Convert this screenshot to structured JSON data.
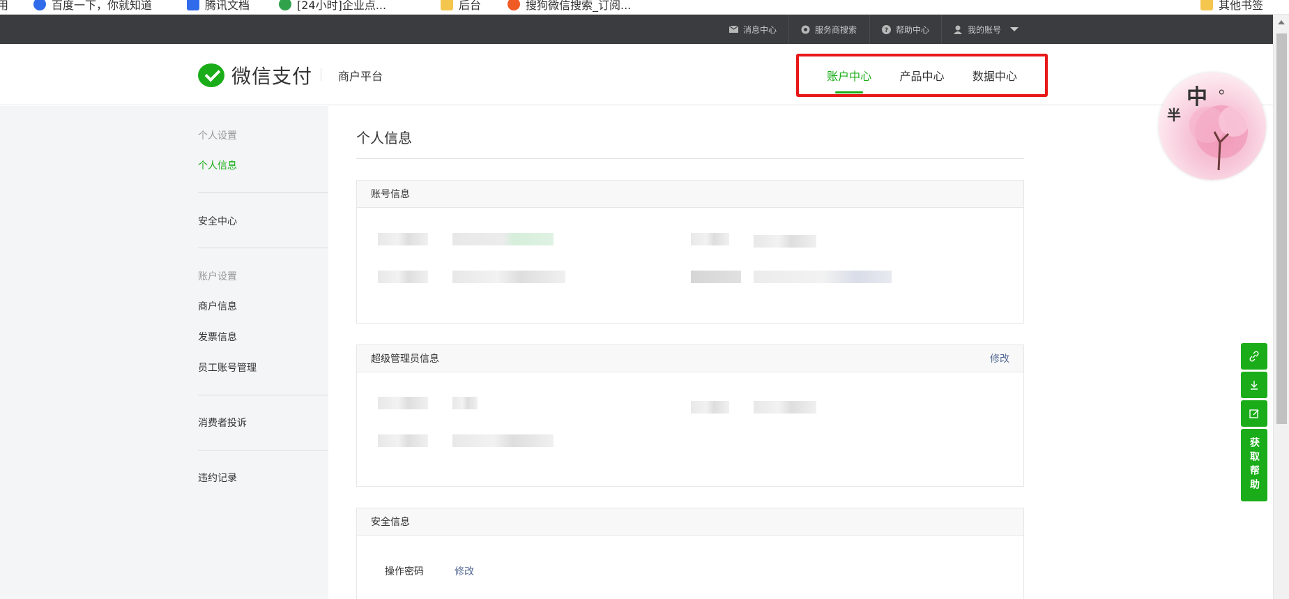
{
  "bookmarks": [
    {
      "label": "用",
      "icon": "folder-icon"
    },
    {
      "label": "百度一下，你就知道",
      "icon": "baidu-icon"
    },
    {
      "label": "腾讯文档",
      "icon": "tencent-docs-icon"
    },
    {
      "label": "[24小时]企业点...",
      "icon": "leaf-icon"
    },
    {
      "label": "后台",
      "icon": "folder-icon"
    },
    {
      "label": "搜狗微信搜索_订阅...",
      "icon": "sogou-icon"
    },
    {
      "label": "其他书签",
      "icon": "folder-icon"
    }
  ],
  "topbar": {
    "messages": "消息中心",
    "provider_search": "服务商搜索",
    "help": "帮助中心",
    "account": "我的账号"
  },
  "header": {
    "logo_text": "微信支付",
    "subtitle": "商户平台",
    "nav": [
      {
        "label": "账户中心",
        "active": true
      },
      {
        "label": "产品中心",
        "active": false
      },
      {
        "label": "数据中心",
        "active": false
      }
    ]
  },
  "sidebar": {
    "personal_group": "个人设置",
    "personal_info": "个人信息",
    "security": "安全中心",
    "account_group": "账户设置",
    "merchant_info": "商户信息",
    "invoice_info": "发票信息",
    "staff": "员工账号管理",
    "complaints": "消费者投诉",
    "violations": "违约记录"
  },
  "main": {
    "title": "个人信息",
    "account_panel": {
      "title": "账号信息"
    },
    "admin_panel": {
      "title": "超级管理员信息",
      "edit": "修改"
    },
    "security_panel": {
      "title": "安全信息",
      "row_label": "操作密码",
      "edit": "修改"
    }
  },
  "float_tools": {
    "help_label": "获取帮助"
  },
  "colors": {
    "brand_green": "#1aad19",
    "highlight_red": "#e81818",
    "link_blue": "#576b95",
    "topbar_dark": "#3a3c3f"
  }
}
